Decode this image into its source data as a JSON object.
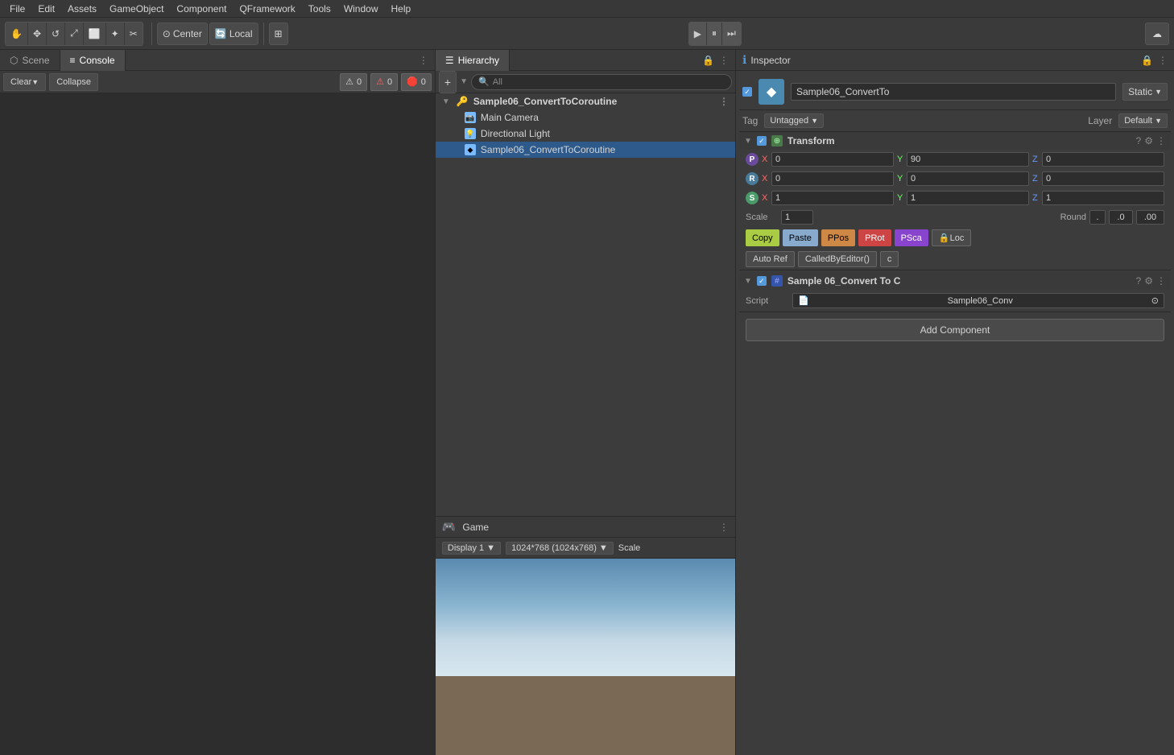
{
  "menuBar": {
    "items": [
      "File",
      "Edit",
      "Assets",
      "GameObject",
      "Component",
      "QFramework",
      "Tools",
      "Window",
      "Help"
    ]
  },
  "toolbar": {
    "tools": [
      "✋",
      "✥",
      "↺",
      "⤢",
      "⬜",
      "🔍",
      "✂"
    ],
    "center_label": "Center",
    "local_label": "Local",
    "grid_icon": "⊞",
    "play_icon": "▶",
    "pause_icon": "⏸",
    "step_icon": "⏭",
    "cloud_icon": "☁"
  },
  "leftPanel": {
    "tabs": [
      {
        "label": "Scene",
        "icon": "⬡",
        "active": false
      },
      {
        "label": "Console",
        "icon": "≡",
        "active": true
      }
    ],
    "console": {
      "clear_label": "Clear",
      "collapse_label": "Collapse",
      "warnings": 0,
      "errors": 0,
      "info": 0
    }
  },
  "hierarchyPanel": {
    "title": "Hierarchy",
    "search_placeholder": "All",
    "items": [
      {
        "label": "Sample06_ConvertToCoroutine",
        "level": "root",
        "selected": false
      },
      {
        "label": "Main Camera",
        "level": "child",
        "selected": false
      },
      {
        "label": "Directional Light",
        "level": "child",
        "selected": false
      },
      {
        "label": "Sample06_ConvertToCoroutine",
        "level": "child",
        "selected": true
      }
    ]
  },
  "gamePanel": {
    "title": "Game",
    "icon": "🎮",
    "display_label": "Display 1",
    "resolution_label": "1024*768 (1024x768)",
    "scale_label": "Scale"
  },
  "inspector": {
    "title": "Inspector",
    "object_name": "Sample06_ConvertTo",
    "static_label": "Static",
    "tag_label": "Tag",
    "tag_value": "Untagged",
    "layer_label": "Layer",
    "layer_value": "Default",
    "transform": {
      "title": "Transform",
      "position": {
        "label": "P",
        "x": "0",
        "y": "90",
        "z": "0"
      },
      "rotation": {
        "label": "R",
        "x": "0",
        "y": "0",
        "z": "0"
      },
      "scale": {
        "label": "S",
        "x": "1",
        "y": "1",
        "z": "1"
      },
      "scale_label": "Scale",
      "scale_value": "1",
      "round_label": "Round",
      "dot_label": ".",
      "zero_label": ".0",
      "double_zero_label": ".00",
      "buttons": {
        "copy": "Copy",
        "paste": "Paste",
        "ppos": "PPos",
        "prot": "PRot",
        "psca": "PSca",
        "ploc": "🔒Loc",
        "autoref": "Auto Ref",
        "called_by_editor": "CalledByEditor()",
        "c": "c"
      }
    },
    "script_component": {
      "title": "Sample 06_Convert To C",
      "script_label": "Script",
      "script_value": "Sample06_Conv"
    },
    "add_component_label": "Add Component"
  }
}
